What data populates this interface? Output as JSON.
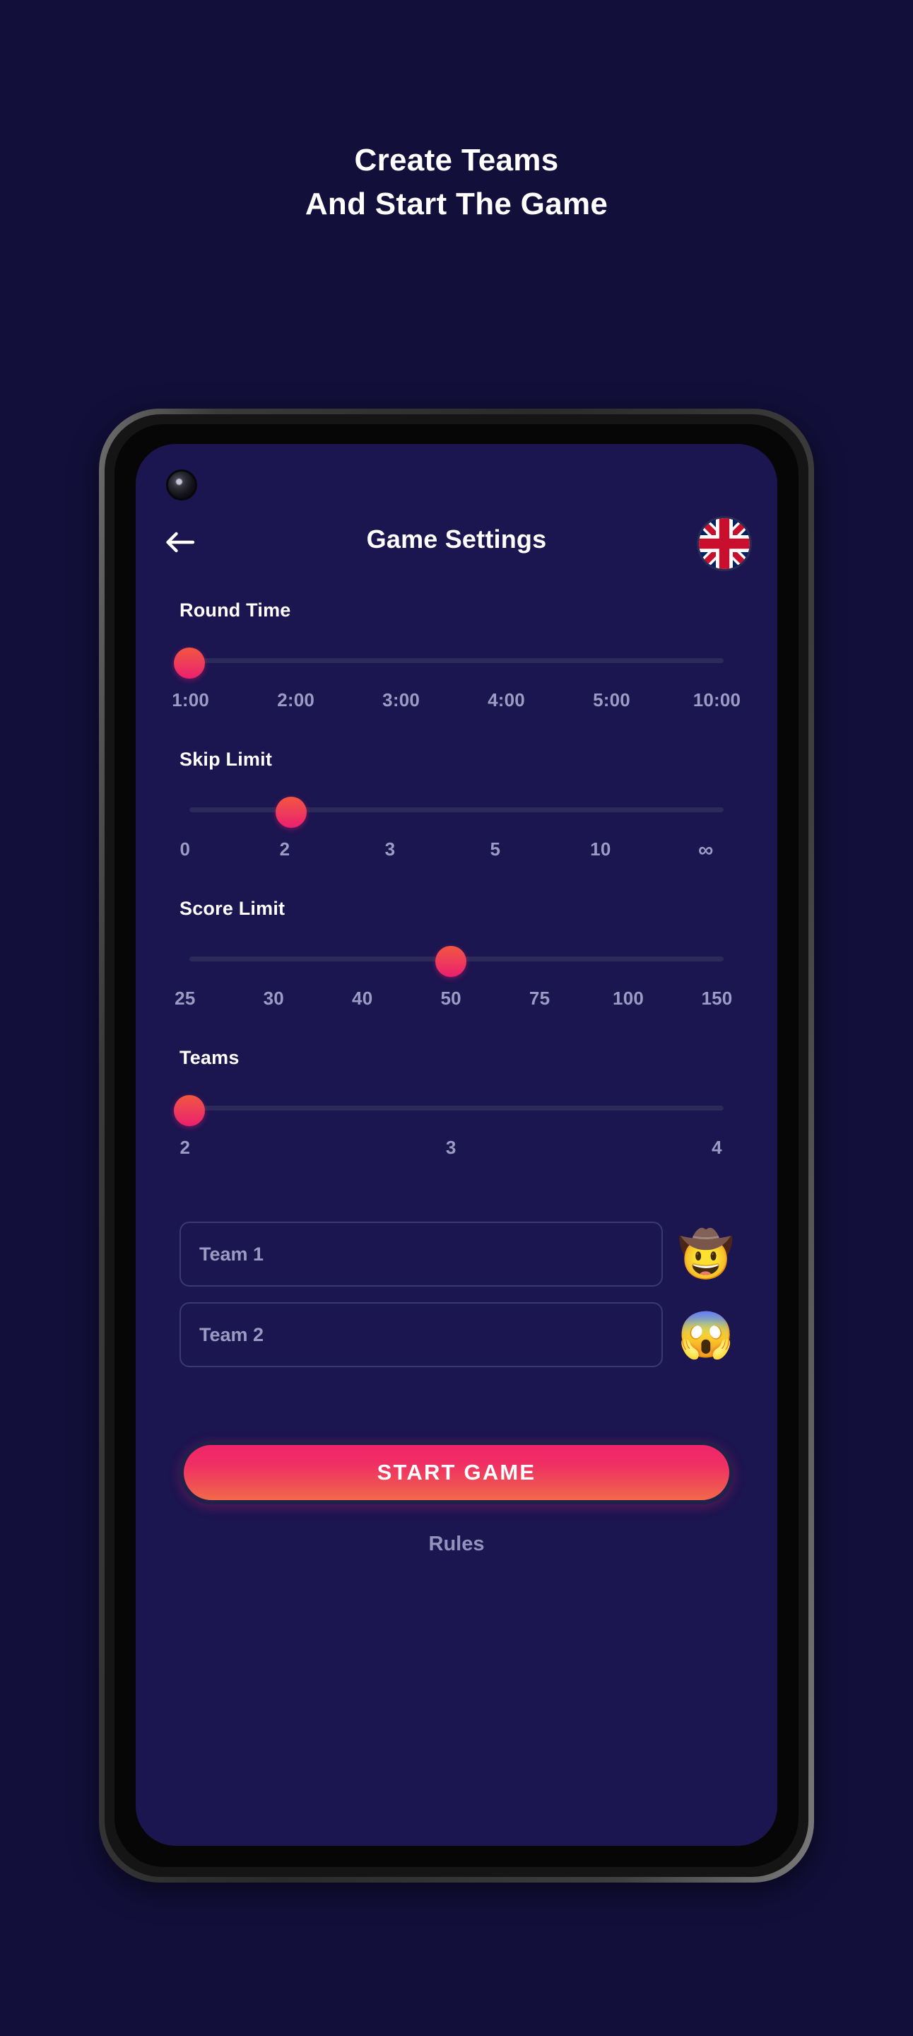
{
  "promo": {
    "line1": "Create Teams",
    "line2": "And Start The Game"
  },
  "app": {
    "header": {
      "title": "Game Settings",
      "back_icon": "arrow-left-icon",
      "language_flag": "uk-flag-icon"
    },
    "settings": [
      {
        "label": "Round Time",
        "ticks": [
          "1:00",
          "2:00",
          "3:00",
          "4:00",
          "5:00",
          "10:00"
        ],
        "selected_index": 0,
        "selected_value": "1:00"
      },
      {
        "label": "Skip Limit",
        "ticks": [
          "0",
          "2",
          "3",
          "5",
          "10",
          "∞"
        ],
        "selected_index": 1,
        "selected_value": "2"
      },
      {
        "label": "Score Limit",
        "ticks": [
          "25",
          "30",
          "40",
          "50",
          "75",
          "100",
          "150"
        ],
        "selected_index": 3,
        "selected_value": "50"
      },
      {
        "label": "Teams",
        "ticks": [
          "2",
          "3",
          "4"
        ],
        "selected_index": 0,
        "selected_value": "2"
      }
    ],
    "teams": [
      {
        "placeholder": "Team 1",
        "value": "",
        "emoji": "🤠",
        "emoji_name": "cowboy-hat-face-emoji"
      },
      {
        "placeholder": "Team 2",
        "value": "",
        "emoji": "😱",
        "emoji_name": "screaming-face-emoji"
      }
    ],
    "start_button": "START GAME",
    "rules_link": "Rules"
  },
  "colors": {
    "page_background": "#120f3a",
    "screen_background": "#1b1550",
    "accent_pink": "#ec1f6d",
    "accent_orange": "#f2694a",
    "slider_track": "#2b2a58",
    "muted_text": "#9b9bc4"
  }
}
